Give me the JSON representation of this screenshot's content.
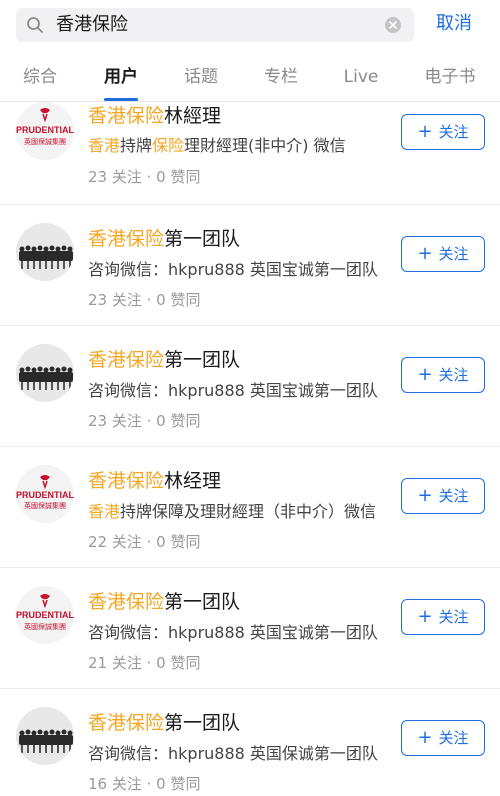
{
  "search": {
    "query": "香港保险",
    "cancel_label": "取消"
  },
  "tabs": [
    {
      "label": "综合"
    },
    {
      "label": "用户"
    },
    {
      "label": "话题"
    },
    {
      "label": "专栏"
    },
    {
      "label": "Live"
    },
    {
      "label": "电子书"
    }
  ],
  "active_tab": "用户",
  "results": [
    {
      "name_highlight": "香港保险",
      "name_rest": "林經理",
      "desc_highlight_1": "香港",
      "desc_mid_1": "持牌",
      "desc_highlight_2": "保险",
      "desc_rest": "理財經理(非中介) 微信",
      "stats": "23 关注 · 0 赞同",
      "avatar": "prudential-logo",
      "follow_label": "关注"
    },
    {
      "name_highlight": "香港保险",
      "name_rest": "第一团队",
      "desc": "咨询微信：hkpru888 英国宝诚第一团队",
      "stats": "23 关注 · 0 赞同",
      "avatar": "team-photo",
      "follow_label": "关注"
    },
    {
      "name_highlight": "香港保险",
      "name_rest": "第一团队",
      "desc": "咨询微信：hkpru888 英国宝诚第一团队",
      "stats": "23 关注 · 0 赞同",
      "avatar": "team-photo",
      "follow_label": "关注"
    },
    {
      "name_highlight": "香港保险",
      "name_rest": "林经理",
      "desc_highlight_1": "香港",
      "desc_rest": "持牌保障及理財經理（非中介）微信",
      "stats": "22 关注 · 0 赞同",
      "avatar": "prudential-logo",
      "follow_label": "关注"
    },
    {
      "name_highlight": "香港保险",
      "name_rest": "第一团队",
      "desc": "咨询微信：hkpru888 英国宝诚第一团队",
      "stats": "21 关注 · 0 赞同",
      "avatar": "prudential-logo",
      "follow_label": "关注"
    },
    {
      "name_highlight": "香港保险",
      "name_rest": "第一团队",
      "desc": "咨询微信：hkpru888 英国保诚第一团队",
      "stats": "16 关注 · 0 赞同",
      "avatar": "team-photo",
      "follow_label": "关注"
    }
  ],
  "logo": {
    "brand_text": "PRUDENTIAL",
    "brand_cn": "英國保誠集團",
    "brand_color": "#c8102e"
  },
  "colors": {
    "accent": "#1e6ee0",
    "highlight": "#f5a623"
  }
}
